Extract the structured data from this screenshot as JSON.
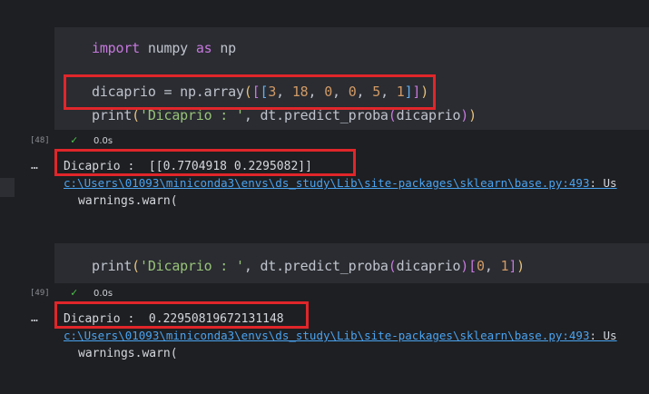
{
  "cell1": {
    "exec_count": "[48]",
    "line1": {
      "kw1": "import",
      "mid": " numpy ",
      "kw2": "as",
      "end": " np"
    },
    "line2": {
      "a": "dicaprio = np.array",
      "b": "(",
      "c": "[",
      "d": "[",
      "n1": "3",
      "s1": ", ",
      "n2": "18",
      "s2": ", ",
      "n3": "0",
      "s3": ", ",
      "n4": "0",
      "s4": ", ",
      "n5": "5",
      "s5": ", ",
      "n6": "1",
      "e1": "]",
      "e2": "]",
      "e3": ")"
    },
    "line3": {
      "a": "print",
      "b": "(",
      "str": "'Dicaprio : '",
      "c": ", dt.predict_proba",
      "d": "(",
      "e": "dicaprio",
      "f": ")",
      "g": ")"
    },
    "status_time": "0.0s",
    "output": "Dicaprio :  [[0.7704918 0.2295082]]",
    "warning_link": "c:\\Users\\01093\\miniconda3\\envs\\ds_study\\Lib\\site-packages\\sklearn\\base.py:493",
    "warning_tail": ": Us",
    "warning_text": "warnings.warn("
  },
  "cell2": {
    "exec_count": "[49]",
    "line1": {
      "a": "print",
      "b": "(",
      "str": "'Dicaprio : '",
      "c": ", dt.predict_proba",
      "d": "(",
      "e": "dicaprio",
      "f": ")",
      "g": "[",
      "h": "0",
      "i": ", ",
      "j": "1",
      "k": "]",
      "l": ")"
    },
    "status_time": "0.0s",
    "output": "Dicaprio :  0.22950819672131148",
    "warning_link": "c:\\Users\\01093\\miniconda3\\envs\\ds_study\\Lib\\site-packages\\sklearn\\base.py:493",
    "warning_tail": ": Us",
    "warning_text": "warnings.warn("
  },
  "ellipsis": "…",
  "check_icon": "✓",
  "colors": {
    "highlight": "#e0262a",
    "keyword": "#c678dd",
    "number": "#d19a66",
    "string": "#98c379",
    "link": "#4aa3f0"
  }
}
